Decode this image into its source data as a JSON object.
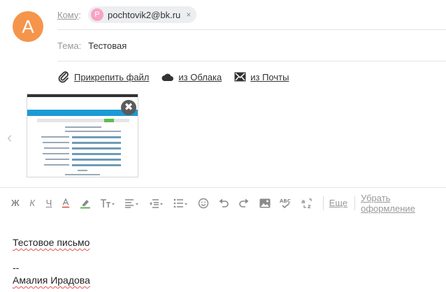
{
  "sender": {
    "avatar_letter": "А",
    "avatar_color": "#f5954b"
  },
  "to": {
    "label": "Кому",
    "recipients": [
      {
        "avatar_letter": "P",
        "email": "pochtovik2@bk.ru",
        "remove": "×"
      }
    ]
  },
  "subject": {
    "label": "Тема:",
    "value": "Тестовая"
  },
  "attach": {
    "file_label": "Прикрепить файл",
    "cloud_label": "из Облака",
    "mail_label": "из Почты"
  },
  "attachment": {
    "close": "✖",
    "prev": "‹"
  },
  "toolbar": {
    "bold": "Ж",
    "italic": "К",
    "underline": "Ч",
    "more_label": "Еще",
    "clear_format_label": "Убрать оформление",
    "icons": [
      "text-color-icon",
      "highlight-icon",
      "font-size-icon",
      "align-icon",
      "indent-icon",
      "list-icon",
      "emoji-icon",
      "undo-icon",
      "redo-icon",
      "image-icon",
      "spellcheck-icon",
      "translate-icon"
    ]
  },
  "body": {
    "line1": "Тестовое письмо",
    "line2": "--",
    "line3": "Амалия Ирадова"
  }
}
